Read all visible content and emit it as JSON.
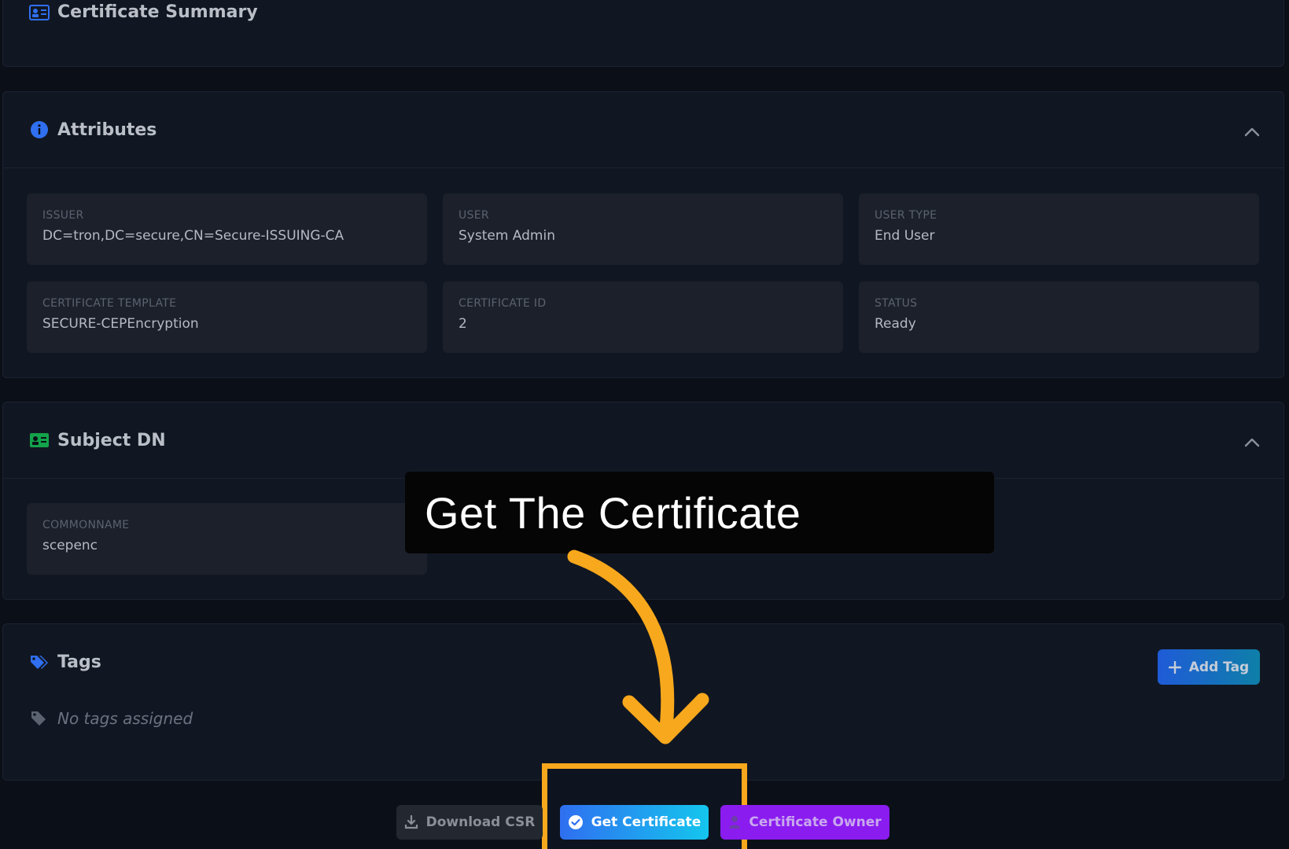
{
  "summary": {
    "title": "Certificate Summary"
  },
  "attributes": {
    "title": "Attributes",
    "fields": [
      {
        "label": "ISSUER",
        "value": "DC=tron,DC=secure,CN=Secure-ISSUING-CA"
      },
      {
        "label": "USER",
        "value": "System Admin"
      },
      {
        "label": "USER TYPE",
        "value": "End User"
      },
      {
        "label": "CERTIFICATE TEMPLATE",
        "value": "SECURE-CEPEncryption"
      },
      {
        "label": "CERTIFICATE ID",
        "value": "2"
      },
      {
        "label": "STATUS",
        "value": "Ready"
      }
    ]
  },
  "subject_dn": {
    "title": "Subject DN",
    "fields": [
      {
        "label": "COMMONNAME",
        "value": "scepenc"
      }
    ]
  },
  "tags": {
    "title": "Tags",
    "add_label": "Add Tag",
    "empty_text": "No tags assigned"
  },
  "actions": {
    "download_csr": "Download CSR",
    "get_certificate": "Get Certificate",
    "certificate_owner": "Certificate Owner"
  },
  "annotation": {
    "text": "Get The Certificate"
  },
  "colors": {
    "accent_blue": "#2f6ff0",
    "accent_cyan": "#14c6ee",
    "accent_purple": "#8a1cf0",
    "highlight": "#f8a81c"
  },
  "icons": {
    "summary": "id-card-icon",
    "attributes": "info-icon",
    "subject": "id-card-icon",
    "tags": "tags-icon",
    "tag": "tag-icon",
    "download": "download-icon",
    "check": "check-circle-icon",
    "user": "user-icon",
    "plus": "plus-icon",
    "chevron": "chevron-up-icon"
  }
}
